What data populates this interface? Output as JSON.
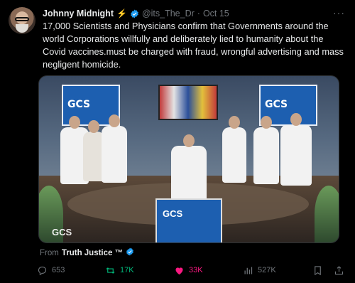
{
  "tweet": {
    "author_name": "Johnny Midnight",
    "author_handle": "@its_The_Dr",
    "separator": "·",
    "time": "Oct 15",
    "text": "17,000 Scientists and Physicians confirm that Governments around the world Corporations willfully and deliberately lied to humanity about the Covid vaccines.must be charged with fraud, wrongful advertising and mass negligent homicide.",
    "more_label": "···"
  },
  "media": {
    "logo_text": "GCS",
    "watermark_text": "GCS"
  },
  "source": {
    "prefix": "From",
    "name": "Truth Justice ™"
  },
  "stats": {
    "replies": "653",
    "reposts": "17K",
    "likes": "33K",
    "views": "527K"
  },
  "colors": {
    "verified": "#1d9bf0",
    "repost_active": "#00ba7c",
    "like_active": "#f91880",
    "muted": "#71767b"
  },
  "icons": [
    "reply-icon",
    "repost-icon",
    "like-icon",
    "views-icon",
    "bookmark-icon",
    "share-icon"
  ]
}
